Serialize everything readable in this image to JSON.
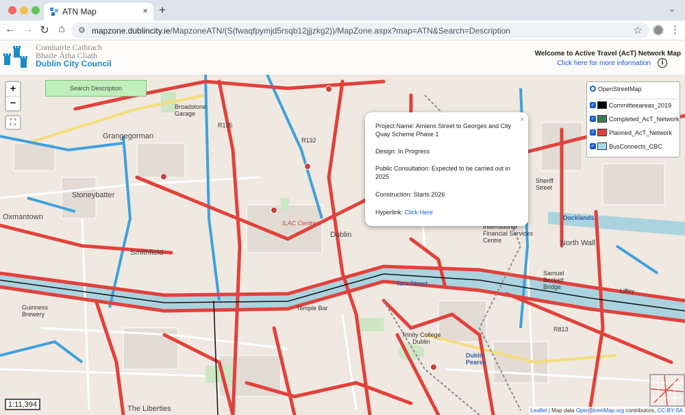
{
  "browser": {
    "tab_title": "ATN Map",
    "tab_close": "×",
    "new_tab": "+",
    "tab_menu": "⌄",
    "url_host": "mapzone.dublincity.ie",
    "url_path": "/MapzoneATN/(S(fwaqfpymjd5rsqb12jjjzkg2))/MapZone.aspx?map=ATN&Search=Description"
  },
  "header": {
    "council_line1": "Comhairle Cathrach",
    "council_line2": "Bhaile Átha Cliath",
    "council_main": "Dublin City Council",
    "welcome": "Welcome to Active Travel (AcT) Network Map",
    "info_link": "Click here for more information",
    "info_icon": "i"
  },
  "controls": {
    "zoom_in": "+",
    "zoom_out": "−",
    "fullscreen": "⛶",
    "search_label": "Search Description",
    "scale": "1:11,394"
  },
  "layers": {
    "base": "OpenStreetMap",
    "overlays": [
      {
        "label": "Committeeareas_2019",
        "color": "#000000"
      },
      {
        "label": "Completed_AcT_Network",
        "color": "#3b7a57"
      },
      {
        "label": "Planned_AcT_Network",
        "color": "#e2413b"
      },
      {
        "label": "BusConnects_CBC",
        "color": "#a6d8ec"
      }
    ]
  },
  "popup": {
    "close": "×",
    "project": "Project Name: Amiens Street to Georges and City Quay Scheme Phase 1",
    "design": "Design: In Progress",
    "consultation": "Public Consultation: Expected to be carried out in 2025",
    "construction": "Construction: Starts 2026",
    "hyperlink_label": "Hyperlink:",
    "hyperlink_text": "Click Here"
  },
  "attribution": {
    "leaflet": "Leaflet",
    "text": "| Map data",
    "osm": "OpenStreetMap.org",
    "contributors": "contributors,",
    "license": "CC-BY-SA"
  },
  "map_labels": {
    "grangegorman": "Grangegorman",
    "stoneybatter": "Stoneybatter",
    "oxmantown": "Oxmantown",
    "smithfield": "Smithfield",
    "dublin": "Dublin",
    "ilac": "ILAC Centre",
    "templebar": "Temple Bar",
    "tara": "Tara Street",
    "trinity": "Trinity College Dublin",
    "pearse": "Dublin Pearse",
    "guinness": "Guinness Brewery",
    "northwall": "North Wall",
    "docklands": "Docklands",
    "ifsc": "International Financial Services Centre",
    "liberties": "The Liberties",
    "broadstone": "Broadstone Garage",
    "r135": "R135",
    "r132": "R132",
    "r813": "R813",
    "sheriff": "Sheriff Street",
    "samuel": "Samuel Beckett Bridge",
    "liffey": "Liffey"
  }
}
